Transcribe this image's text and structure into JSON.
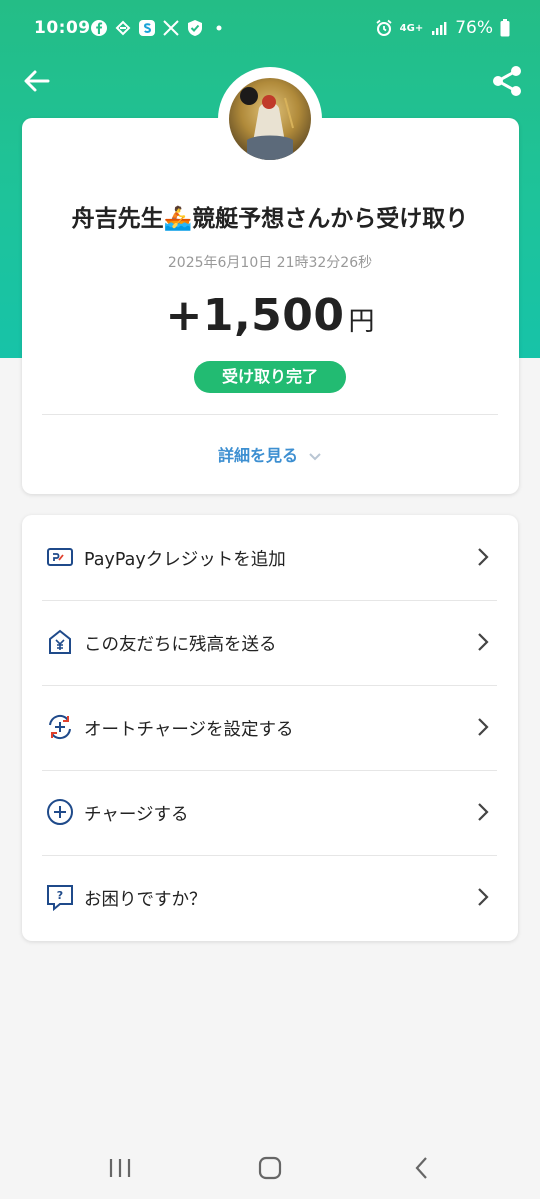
{
  "status_bar": {
    "time": "10:09",
    "battery": "76%",
    "network": "4G+"
  },
  "header": {
    "back_icon": "arrow-left-icon",
    "share_icon": "share-icon"
  },
  "transaction": {
    "title": "舟吉先生🚣競艇予想さんから受け取り",
    "timestamp": "2025年6月10日 21時32分26秒",
    "amount": "+1,500",
    "currency": "円",
    "status": "受け取り完了",
    "details_label": "詳細を見る"
  },
  "menu": {
    "items": [
      {
        "label": "PayPayクレジットを追加",
        "icon": "paypay-card-icon"
      },
      {
        "label": "この友だちに残高を送る",
        "icon": "send-yen-icon"
      },
      {
        "label": "オートチャージを設定する",
        "icon": "auto-charge-icon"
      },
      {
        "label": "チャージする",
        "icon": "plus-circle-icon"
      },
      {
        "label": "お困りですか？",
        "icon": "help-chat-icon"
      }
    ]
  },
  "colors": {
    "header_green": "#24bd86",
    "badge_green": "#22bb72",
    "link_blue": "#3d8fd1",
    "icon_navy": "#1f4a8a"
  }
}
